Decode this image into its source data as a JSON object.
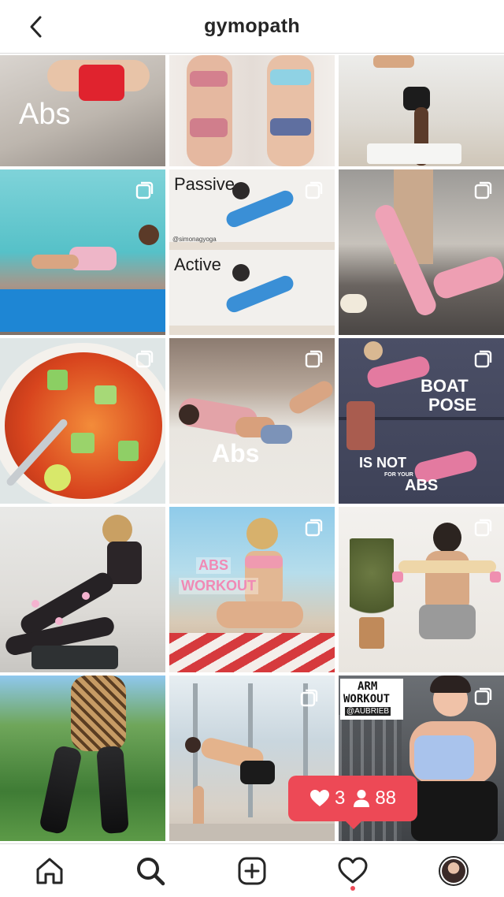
{
  "header": {
    "title": "gymopath",
    "back_icon": "chevron-left-icon"
  },
  "grid": {
    "tiles": [
      {
        "id": "abs-red-shorts",
        "overlay": "Abs"
      },
      {
        "id": "bikini-comparison",
        "overlay": ""
      },
      {
        "id": "handstand",
        "overlay": ""
      },
      {
        "id": "resistance-band-pool",
        "overlay": ""
      },
      {
        "id": "passive-active-stretch",
        "overlay_top": "Passive",
        "overlay_handle": "@simonagyoga",
        "overlay_bottom": "Active"
      },
      {
        "id": "leg-raise-pink",
        "overlay": ""
      },
      {
        "id": "soup-bowl",
        "overlay": ""
      },
      {
        "id": "abs-lying",
        "overlay": "Abs"
      },
      {
        "id": "boat-pose",
        "overlay_top": "BOAT",
        "overlay_mid": "POSE",
        "overlay_bottom_a": "IS NOT",
        "overlay_bottom_small": "FOR YOUR",
        "overlay_bottom_b": "ABS"
      },
      {
        "id": "floral-leggings",
        "overlay": ""
      },
      {
        "id": "abs-workout-beach",
        "overlay_a": "ABS",
        "overlay_b": "WORKOUT"
      },
      {
        "id": "back-kneeling",
        "overlay": ""
      },
      {
        "id": "leopard-leggings",
        "overlay": ""
      },
      {
        "id": "side-plank",
        "overlay": ""
      },
      {
        "id": "arm-workout",
        "overlay_a": "ARM",
        "overlay_b": "WORKOUT",
        "overlay_c": "@AUBRIEB"
      }
    ]
  },
  "notification": {
    "likes_icon": "heart-icon",
    "likes": "3",
    "followers_icon": "person-icon",
    "followers": "88"
  },
  "tabbar": {
    "items": [
      "home-icon",
      "search-icon",
      "add-post-icon",
      "activity-heart-icon",
      "profile-avatar"
    ]
  },
  "colors": {
    "accent": "#ed4956",
    "text": "#262626",
    "divider": "#dbdbdb"
  }
}
